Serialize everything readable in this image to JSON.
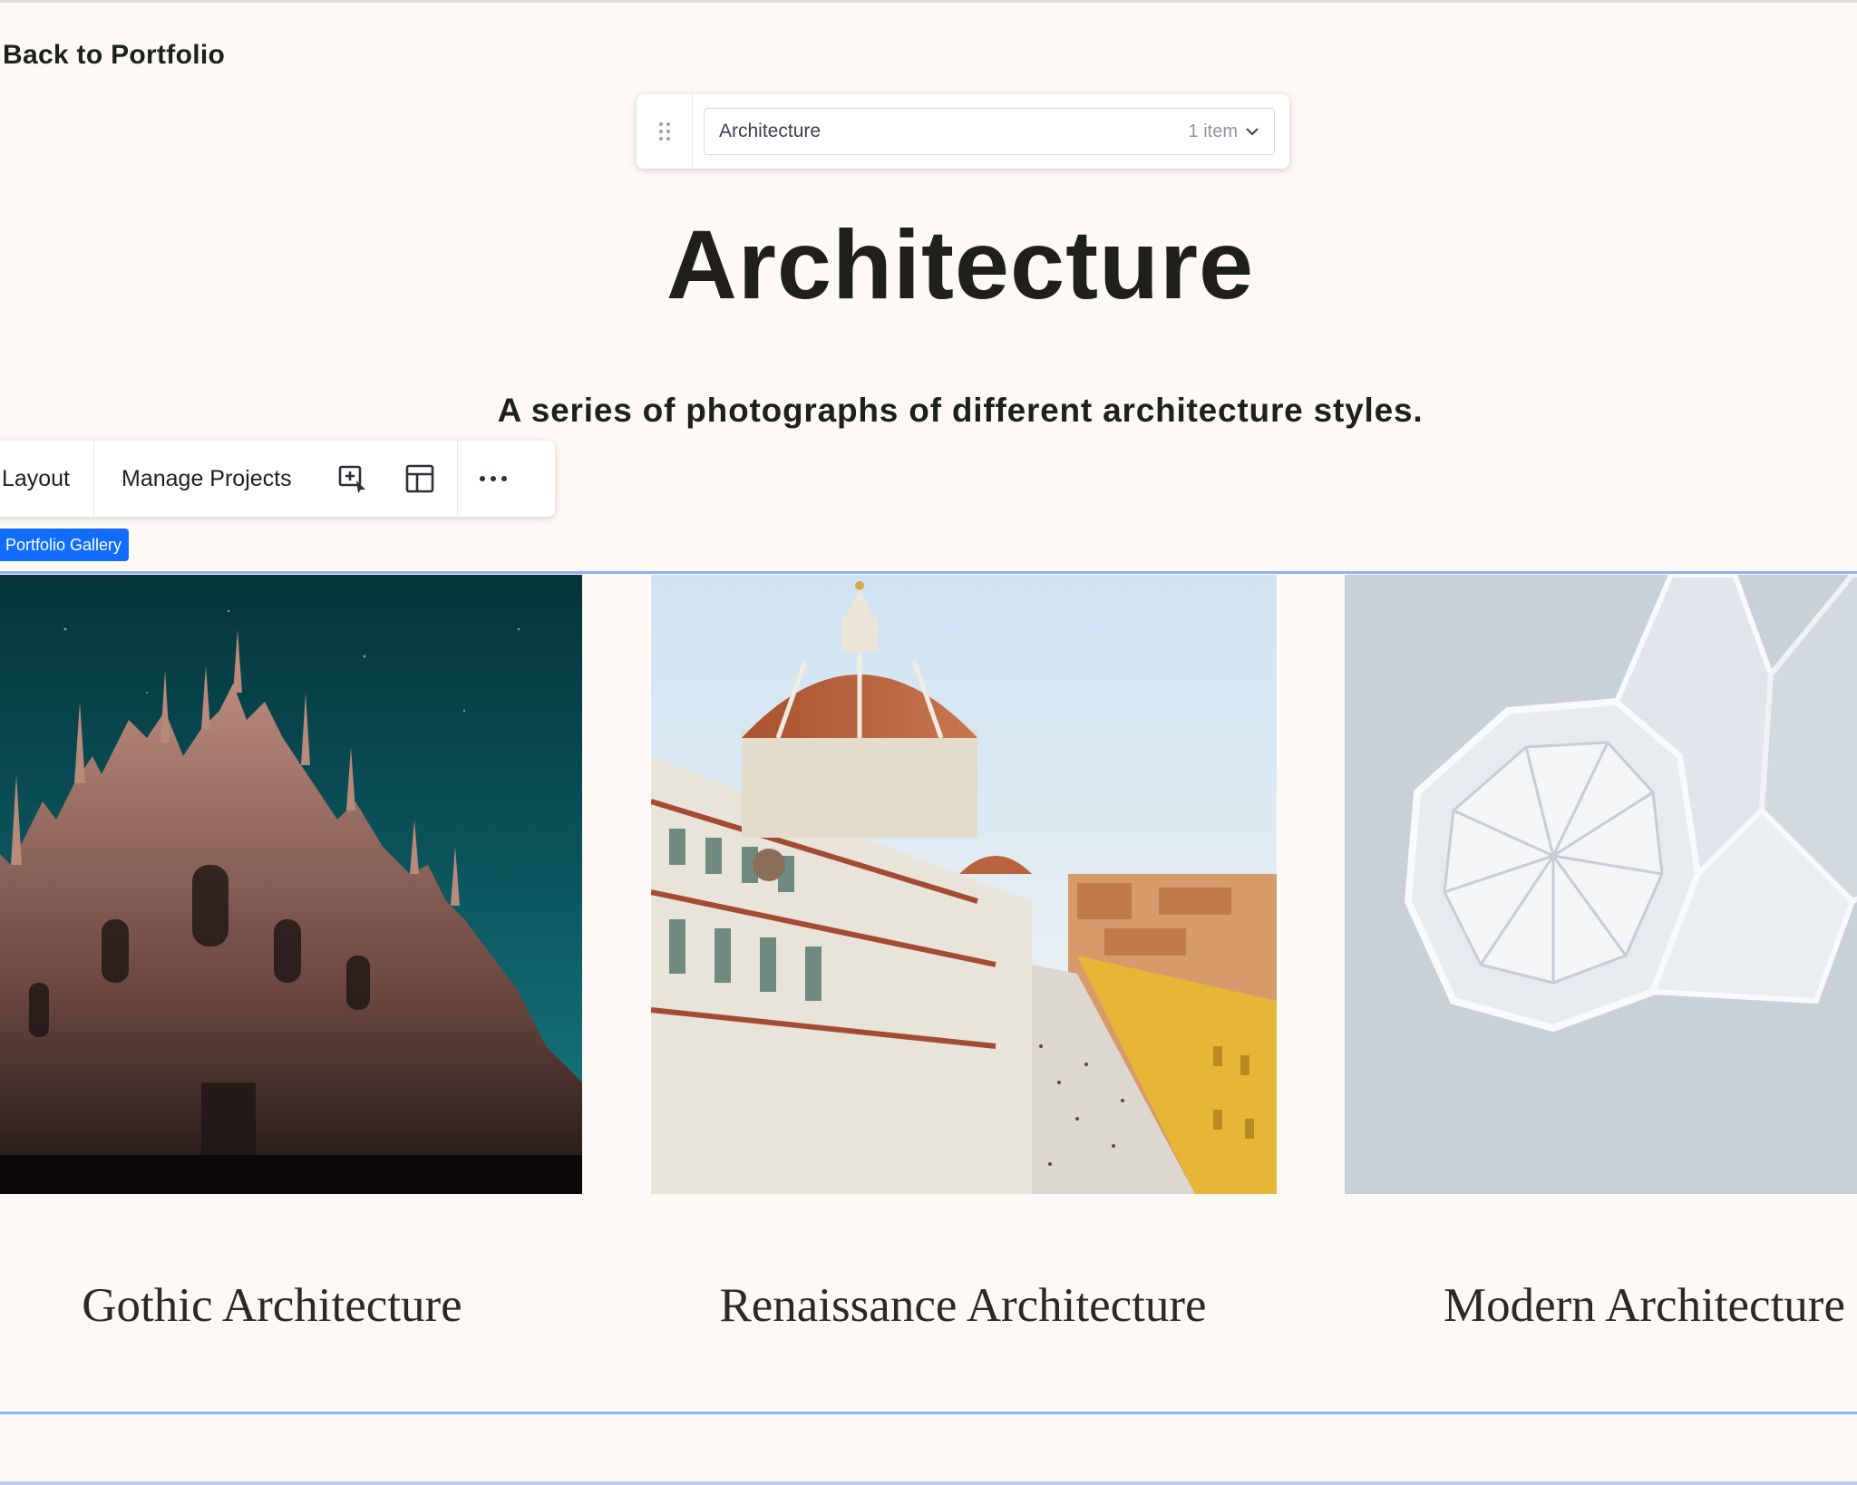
{
  "back_link": "Back to Portfolio",
  "selector": {
    "value": "Architecture",
    "count": "1 item"
  },
  "page": {
    "title": "Architecture",
    "subtitle": "A series of photographs of different architecture styles."
  },
  "toolbar": {
    "layout_label": "Layout",
    "manage_label": "Manage Projects",
    "icons": [
      "add-project-icon",
      "layout-icon",
      "more-icon"
    ]
  },
  "gallery_tag": "Portfolio Gallery",
  "projects": [
    {
      "title": "Gothic Architecture"
    },
    {
      "title": "Renaissance Architecture"
    },
    {
      "title": "Modern Architecture"
    }
  ],
  "colors": {
    "background": "#fdfaf5",
    "text": "#1e2019",
    "accent_blue": "#116dff",
    "selection_border": "#8fb2f5"
  }
}
